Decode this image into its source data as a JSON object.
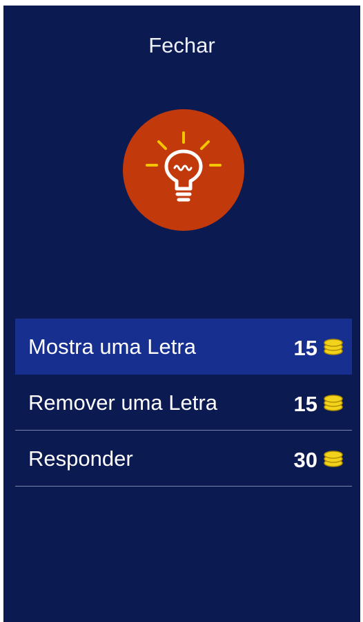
{
  "dialog": {
    "close_label": "Fechar",
    "icon": "lightbulb-icon"
  },
  "colors": {
    "background": "#0c1a52",
    "selected_row": "#17308f",
    "icon_circle": "#c23a0b",
    "bulb_rays": "#f5c400",
    "coin": "#f2d21a"
  },
  "options": [
    {
      "label": "Mostra uma Letra",
      "price": "15",
      "icon": "coins-icon",
      "selected": true
    },
    {
      "label": "Remover uma Letra",
      "price": "15",
      "icon": "coins-icon",
      "selected": false
    },
    {
      "label": "Responder",
      "price": "30",
      "icon": "coins-icon",
      "selected": false
    }
  ]
}
